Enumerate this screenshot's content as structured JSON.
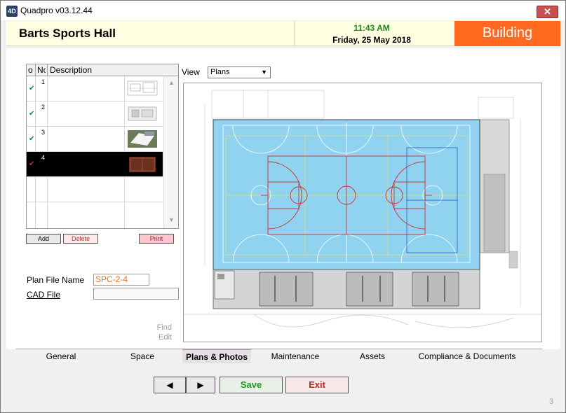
{
  "window": {
    "title": "Quadpro v03.12.44",
    "close_label": "✕",
    "app_icon": "4D"
  },
  "header": {
    "site_name": "Barts Sports Hall",
    "time": "11:43 AM",
    "date": "Friday, 25 May 2018",
    "module": "Building"
  },
  "plans": {
    "columns": [
      "o",
      "No",
      "Description"
    ],
    "rows": [
      {
        "num": "1",
        "checked": "✔",
        "description": ""
      },
      {
        "num": "2",
        "checked": "✔",
        "description": ""
      },
      {
        "num": "3",
        "checked": "✔",
        "description": ""
      },
      {
        "num": "4",
        "checked": "✔",
        "description": ""
      }
    ],
    "add_label": "Add",
    "delete_label": "Delete",
    "print_label": "Print"
  },
  "fields": {
    "plan_file_label": "Plan File Name",
    "plan_file_value": "SPC-2-4",
    "cad_file_label": "CAD File",
    "cad_file_value": "",
    "find_label": "Find",
    "edit_label": "Edit"
  },
  "view": {
    "label": "View",
    "selected": "Plans"
  },
  "tabs": [
    "General",
    "Space",
    "Plans & Photos",
    "Maintenance",
    "Assets",
    "Compliance & Documents"
  ],
  "nav": {
    "prev": "◀",
    "next": "▶",
    "save": "Save",
    "exit": "Exit"
  },
  "page_number": "3",
  "colors": {
    "accent": "#ff6a20",
    "court": "#8fd3f0",
    "selected_row": "#000000"
  }
}
